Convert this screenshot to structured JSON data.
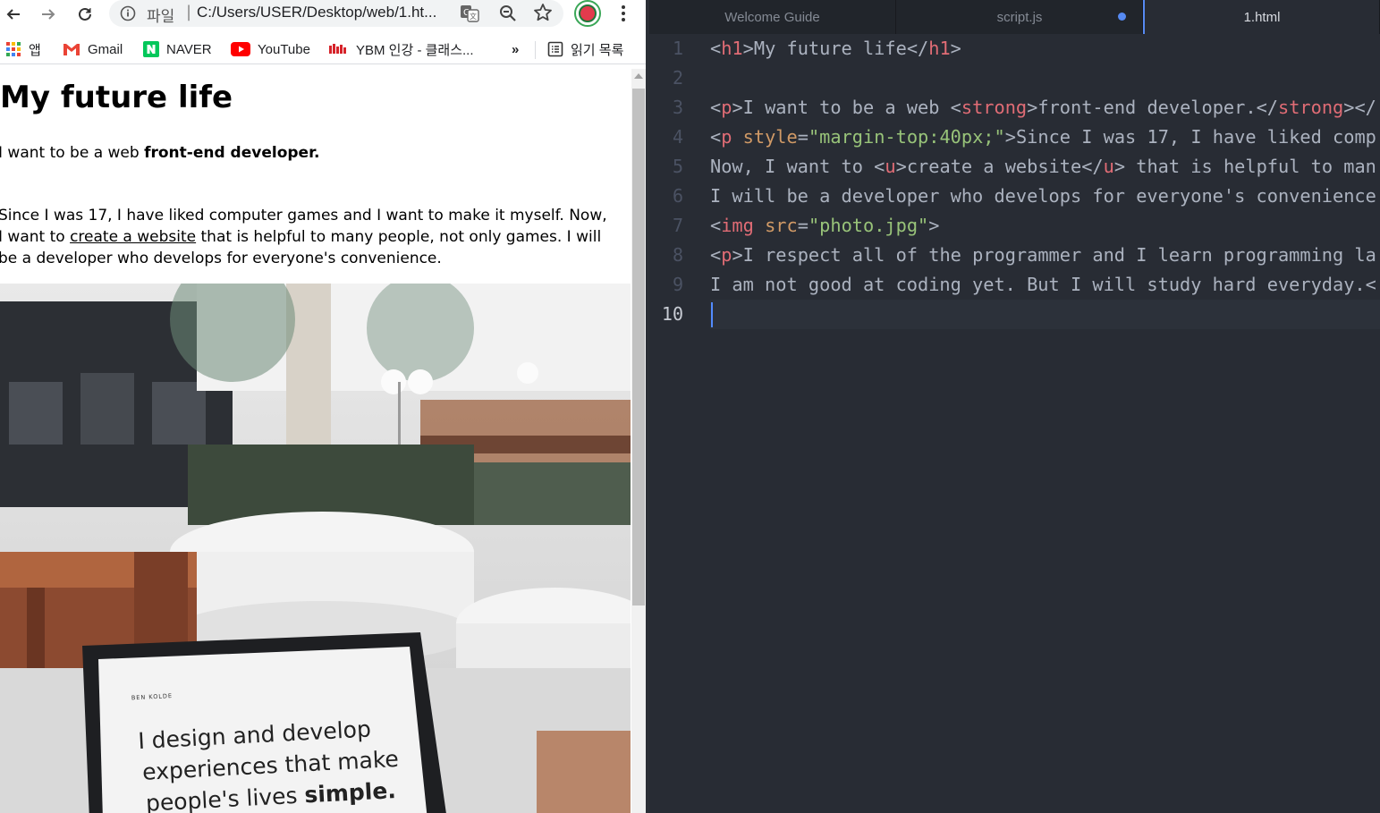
{
  "browser": {
    "address_bar": {
      "protocol_label": "파일",
      "url": "C:/Users/USER/Desktop/web/1.ht..."
    },
    "bookmarks": [
      {
        "label": "앱",
        "icon": "apps-grid-icon"
      },
      {
        "label": "Gmail",
        "icon": "gmail-icon"
      },
      {
        "label": "NAVER",
        "icon": "naver-icon"
      },
      {
        "label": "YouTube",
        "icon": "youtube-icon"
      },
      {
        "label": "YBM 인강 - 클래스...",
        "icon": "ybm-icon"
      }
    ],
    "bookmarks_overflow": "»",
    "reading_list_label": "읽기 목록",
    "page": {
      "heading": "My future life",
      "p1_prefix": "I want to be a web ",
      "p1_strong": "front-end developer.",
      "p2_start": "Since I was 17, I have liked computer games and I want to make it myself. Now, I want to ",
      "p2_link": "create a website",
      "p2_end": " that is helpful to many people, not only games. I will be a developer who develops for everyone's convenience.",
      "photo_screen_brand": "BEN KOLDE",
      "photo_screen_text_1": "I design and develop",
      "photo_screen_text_2": "experiences that make",
      "photo_screen_text_3a": "people's lives ",
      "photo_screen_text_3b": "simple."
    }
  },
  "editor": {
    "tabs": [
      {
        "label": "Welcome Guide",
        "active": false
      },
      {
        "label": "script.js",
        "active": false,
        "modified": true
      },
      {
        "label": "1.html",
        "active": true
      }
    ],
    "line_numbers": [
      "1",
      "2",
      "3",
      "4",
      "5",
      "6",
      "7",
      "8",
      "9",
      "10"
    ],
    "active_line": 10,
    "code": {
      "l1": {
        "o1": "<",
        "tag1": "h1",
        "c1": ">",
        "text": "My future life",
        "o2": "</",
        "tag2": "h1",
        "c2": ">"
      },
      "l3": {
        "o1": "<",
        "tag1": "p",
        "c1": ">",
        "text1": "I want to be a web ",
        "o2": "<",
        "tag2": "strong",
        "c2": ">",
        "text2": "front-end developer.",
        "o3": "</",
        "tag3": "strong",
        "c3": "></"
      },
      "l4": {
        "o1": "<",
        "tag1": "p",
        "sp": " ",
        "attr": "style",
        "eq": "=",
        "val": "\"margin-top:40px;\"",
        "c1": ">",
        "text": "Since I was 17, I have liked comp"
      },
      "l5": {
        "text1": "Now, I want to ",
        "o1": "<",
        "tag1": "u",
        "c1": ">",
        "text2": "create a website",
        "o2": "</",
        "tag2": "u",
        "c2": ">",
        "text3": " that is helpful to man"
      },
      "l6": {
        "text": "I will be a developer who develops for everyone's convenience"
      },
      "l7": {
        "o1": "<",
        "tag1": "img",
        "sp": " ",
        "attr": "src",
        "eq": "=",
        "val": "\"photo.jpg\"",
        "c1": ">"
      },
      "l8": {
        "o1": "<",
        "tag1": "p",
        "c1": ">",
        "text": "I respect all of the programmer and I learn programming la"
      },
      "l9": {
        "text": "I am not good at coding yet. But I will study hard everyday.<"
      }
    }
  },
  "colors": {
    "editor_bg": "#282c34",
    "tag": "#e06c75",
    "attr": "#d19a66",
    "string": "#98c379",
    "accent": "#568af2"
  }
}
